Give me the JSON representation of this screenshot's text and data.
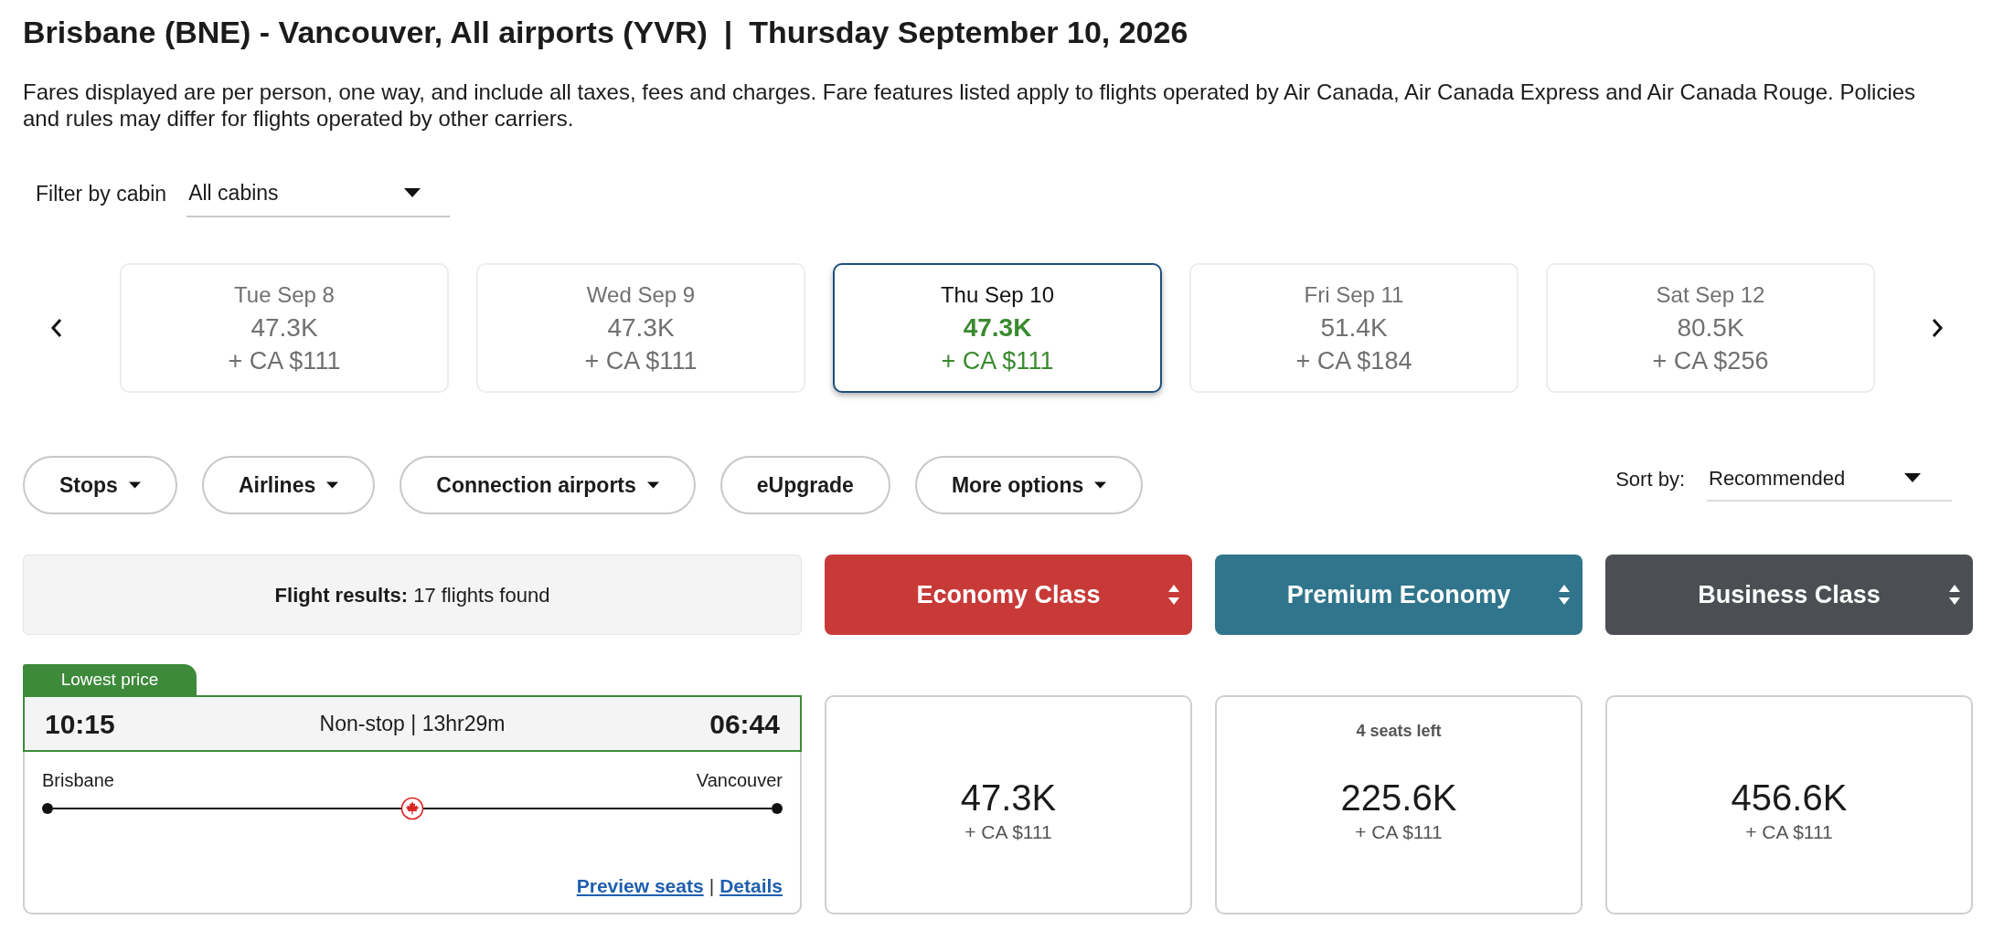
{
  "header": {
    "route": "Brisbane (BNE) - Vancouver, All airports (YVR)",
    "divider": "|",
    "date": "Thursday September 10, 2026",
    "notice": "Fares displayed are per person, one way, and include all taxes, fees and charges. Fare features listed apply to flights operated by Air Canada, Air Canada Express and Air Canada Rouge. Policies and rules may differ for flights operated by other carriers."
  },
  "cabin_filter": {
    "label": "Filter by cabin",
    "value": "All cabins"
  },
  "date_strip": [
    {
      "date": "Tue Sep 8",
      "points": "47.3K",
      "cash": "+ CA $111",
      "selected": false
    },
    {
      "date": "Wed Sep 9",
      "points": "47.3K",
      "cash": "+ CA $111",
      "selected": false
    },
    {
      "date": "Thu Sep 10",
      "points": "47.3K",
      "cash": "+ CA $111",
      "selected": true
    },
    {
      "date": "Fri Sep 11",
      "points": "51.4K",
      "cash": "+ CA $184",
      "selected": false
    },
    {
      "date": "Sat Sep 12",
      "points": "80.5K",
      "cash": "+ CA $256",
      "selected": false
    }
  ],
  "filters": [
    {
      "label": "Stops",
      "dropdown": true
    },
    {
      "label": "Airlines",
      "dropdown": true
    },
    {
      "label": "Connection airports",
      "dropdown": true
    },
    {
      "label": "eUpgrade",
      "dropdown": false
    },
    {
      "label": "More options",
      "dropdown": true
    }
  ],
  "sort": {
    "label": "Sort by:",
    "value": "Recommended"
  },
  "results_summary": "**Flight results:** 17 flights found",
  "cabins": [
    {
      "name": "Economy Class",
      "color": "#c83a38"
    },
    {
      "name": "Premium Economy",
      "color": "#31758c"
    },
    {
      "name": "Business Class",
      "color": "#4b4e53"
    }
  ],
  "flights": [
    {
      "badge": "Lowest price",
      "departure_time": "10:15",
      "summary": "Non-stop | 13hr29m",
      "arrival_time": "06:44",
      "origin": "Brisbane",
      "destination": "Vancouver",
      "links": [
        "Preview seats",
        "Details"
      ],
      "link_separator": "|",
      "fares": [
        {
          "points": "47.3K",
          "cash": "+ CA $111"
        },
        {
          "seats_left": "4 seats left",
          "points": "225.6K",
          "cash": "+ CA $111"
        },
        {
          "points": "456.6K",
          "cash": "+ CA $111"
        }
      ]
    }
  ]
}
